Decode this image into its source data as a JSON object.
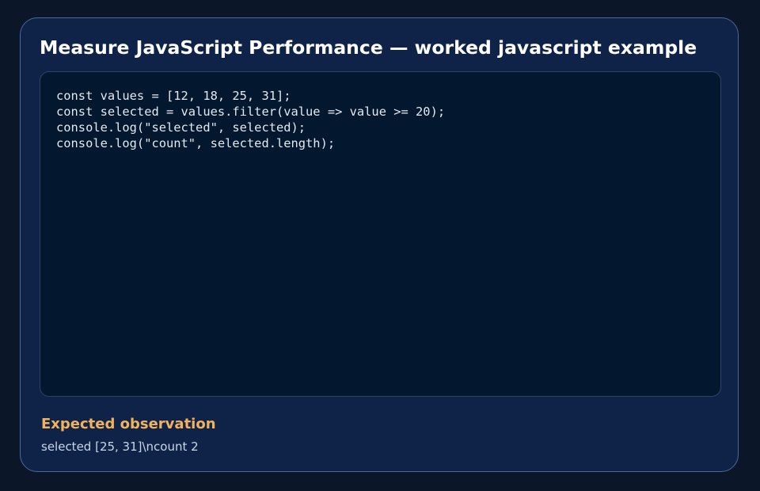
{
  "card": {
    "title": "Measure JavaScript Performance — worked javascript example",
    "code": "const values = [12, 18, 25, 31];\nconst selected = values.filter(value => value >= 20);\nconsole.log(\"selected\", selected);\nconsole.log(\"count\", selected.length);",
    "observation": {
      "heading": "Expected observation",
      "text": "selected [25, 31]\\ncount 2"
    }
  },
  "colors": {
    "page_background": "#0b1628",
    "card_background": "#0e2347",
    "card_border": "#4a6a9a",
    "code_background": "#03172e",
    "title": "#ffffff",
    "code_text": "#e3e9f2",
    "observation_heading": "#f2b25c",
    "observation_text": "#c9d6e8"
  }
}
